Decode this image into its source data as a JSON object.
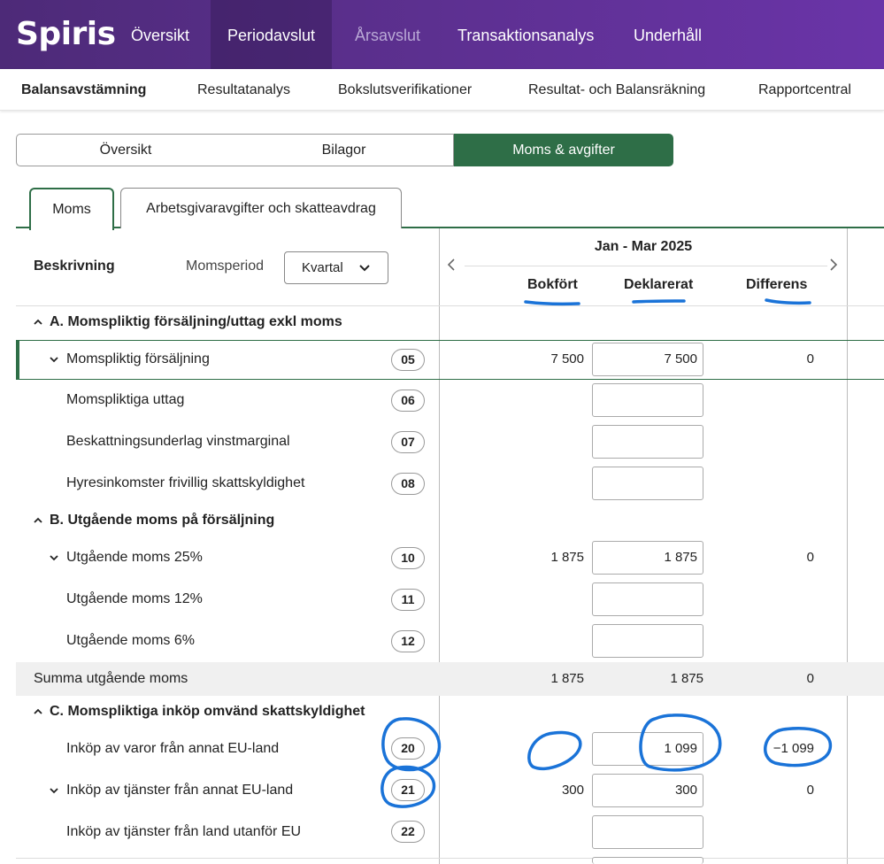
{
  "app": {
    "logo": "Spiris",
    "top_nav": [
      "Översikt",
      "Periodavslut",
      "Årsavslut",
      "Transaktionsanalys",
      "Underhåll"
    ],
    "sub_nav": [
      "Balansavstämning",
      "Resultatanalys",
      "Bokslutsverifikationer",
      "Resultat- och Balansräkning",
      "Rapportcentral"
    ]
  },
  "segments": [
    "Översikt",
    "Bilagor",
    "Moms & avgifter"
  ],
  "tabs": [
    "Moms",
    "Arbetsgivaravgifter och skatteavdrag"
  ],
  "table": {
    "description_header": "Beskrivning",
    "period_label": "Momsperiod",
    "period_select": "Kvartal",
    "period": "Jan - Mar 2025",
    "columns": [
      "Bokfört",
      "Deklarerat",
      "Differens"
    ],
    "sections": {
      "a": "A. Momspliktig försäljning/uttag exkl moms",
      "b": "B. Utgående moms på försäljning",
      "c": "C. Momspliktiga inköp omvänd skattskyldighet"
    },
    "rows": [
      {
        "label": "Momspliktig försäljning",
        "code": "05",
        "booked": "7 500",
        "declared": "7 500",
        "diff": "0"
      },
      {
        "label": "Momspliktiga uttag",
        "code": "06",
        "booked": "",
        "declared": "",
        "diff": ""
      },
      {
        "label": "Beskattningsunderlag vinstmarginal",
        "code": "07",
        "booked": "",
        "declared": "",
        "diff": ""
      },
      {
        "label": "Hyresinkomster frivillig skattskyldighet",
        "code": "08",
        "booked": "",
        "declared": "",
        "diff": ""
      },
      {
        "label": "Utgående moms 25%",
        "code": "10",
        "booked": "1 875",
        "declared": "1 875",
        "diff": "0"
      },
      {
        "label": "Utgående moms 12%",
        "code": "11",
        "booked": "",
        "declared": "",
        "diff": ""
      },
      {
        "label": "Utgående moms 6%",
        "code": "12",
        "booked": "",
        "declared": "",
        "diff": ""
      },
      {
        "label": "Inköp av varor från annat EU-land",
        "code": "20",
        "booked": "",
        "declared": "1 099",
        "diff": "−1 099"
      },
      {
        "label": "Inköp av tjänster från annat EU-land",
        "code": "21",
        "booked": "300",
        "declared": "300",
        "diff": "0"
      },
      {
        "label": "Inköp av tjänster från land utanför EU",
        "code": "22",
        "booked": "",
        "declared": "",
        "diff": ""
      }
    ],
    "summary": {
      "label": "Summa utgående moms",
      "booked": "1 875",
      "declared": "1 875",
      "diff": "0"
    }
  },
  "colors": {
    "purple": "#5a2f8c",
    "green": "#2e6e47",
    "annotation_blue": "#1a73d8"
  }
}
